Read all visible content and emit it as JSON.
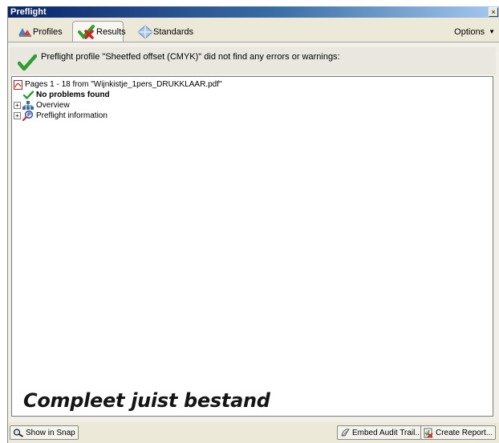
{
  "window": {
    "title": "Preflight",
    "close_glyph": "×"
  },
  "tabs": [
    {
      "label": "Profiles",
      "icon": "profiles-icon",
      "active": false
    },
    {
      "label": "Results",
      "icon": "results-check-icon",
      "active": true
    },
    {
      "label": "Standards",
      "icon": "standards-icon",
      "active": false
    }
  ],
  "options": {
    "label": "Options",
    "caret": "▼"
  },
  "banner": {
    "message": "Preflight profile \"Sheetfed offset (CMYK)\" did not find any errors or warnings:",
    "icon": "check-icon"
  },
  "tree": {
    "root": {
      "label": "Pages 1 - 18 from \"Wijnkistje_1pers_DRUKKLAAR.pdf\"",
      "icon": "pdf-icon"
    },
    "items": [
      {
        "label": "No problems found",
        "icon": "check-icon",
        "bold": true,
        "expander": ""
      },
      {
        "label": "Overview",
        "icon": "overview-icon",
        "bold": false,
        "expander": "+"
      },
      {
        "label": "Preflight information",
        "icon": "preflight-info-icon",
        "bold": false,
        "expander": "+"
      }
    ]
  },
  "caption": "Compleet juist bestand",
  "buttons": {
    "show_in_snap": "Show in Snap",
    "embed_audit_trail": "Embed Audit Trail...",
    "create_report": "Create Report..."
  },
  "colors": {
    "accent_green": "#2e9e2e",
    "error_red": "#d02020",
    "title_blue": "#0a246a"
  }
}
